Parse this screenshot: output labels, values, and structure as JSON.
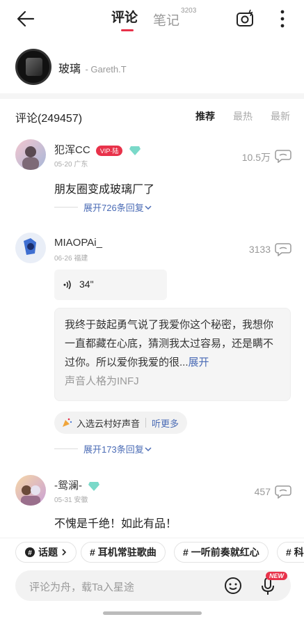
{
  "header": {
    "tabs": [
      {
        "label": "评论",
        "active": true
      },
      {
        "label": "笔记",
        "count": "3203",
        "active": false
      }
    ]
  },
  "song": {
    "title": "玻璃",
    "artist": "- Gareth.T"
  },
  "comments_header": {
    "count_label": "评论(249457)",
    "sort": [
      "推荐",
      "最热",
      "最新"
    ]
  },
  "comments": [
    {
      "user": "犯浑CC",
      "vip_badge": "VIP·陆",
      "meta": "05-20 广东",
      "likes": "10.5万",
      "text": "朋友圈变成玻璃厂了",
      "replies": "展开726条回复"
    },
    {
      "user": "MIAOPAi_",
      "meta": "06-26 福建",
      "likes": "3133",
      "voice_duration": "34\"",
      "quote_text": "我终于鼓起勇气说了我爱你这个秘密，我想你一直都藏在心底，猜测我太过容易，还是瞒不过你。所以爱你我爱的很...",
      "quote_expand": "展开",
      "quote_sub": "声音人格为INFJ",
      "tag_text": "入选云村好声音",
      "tag_more": "听更多",
      "replies": "展开173条回复"
    },
    {
      "user": "-鸳澜-",
      "meta": "05-31 安徽",
      "likes": "457",
      "text": "不愧是千绝！如此有品！"
    }
  ],
  "topics": [
    "话题",
    "耳机常驻歌曲",
    "一听前奏就红心",
    "# 科"
  ],
  "input": {
    "placeholder": "评论为舟，载Ta入星途",
    "new_badge": "NEW"
  },
  "colors": {
    "accent": "#e8324a",
    "link": "#4a6bb5"
  }
}
